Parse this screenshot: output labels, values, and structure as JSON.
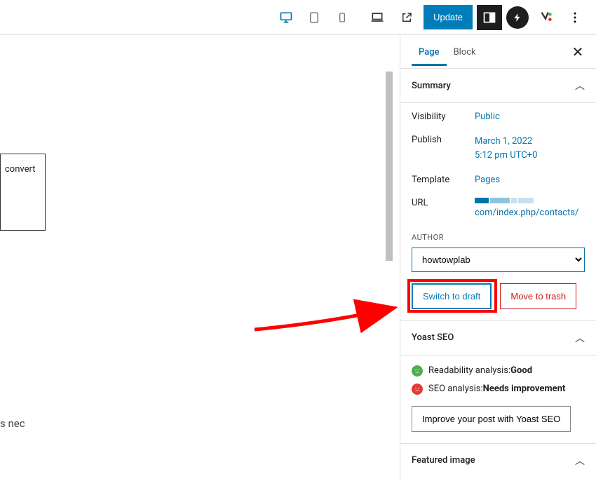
{
  "topbar": {
    "update_label": "Update"
  },
  "tabs": {
    "page_label": "Page",
    "block_label": "Block"
  },
  "summary": {
    "title": "Summary",
    "visibility_label": "Visibility",
    "visibility_value": "Public",
    "publish_label": "Publish",
    "publish_date": "March 1, 2022",
    "publish_time": "5:12 pm UTC+0",
    "template_label": "Template",
    "template_value": "Pages",
    "url_label": "URL",
    "url_value": "com/index.php/contacts/",
    "author_label": "AUTHOR",
    "author_value": "howtowplab",
    "switch_draft_label": "Switch to draft",
    "move_trash_label": "Move to trash"
  },
  "yoast": {
    "title": "Yoast SEO",
    "readability_prefix": "Readability analysis: ",
    "readability_status": "Good",
    "seo_prefix": "SEO analysis: ",
    "seo_status": "Needs improvement",
    "improve_label": "Improve your post with Yoast SEO"
  },
  "featured": {
    "title": "Featured image"
  },
  "content": {
    "fragment_box": "convert",
    "fragment_text": "s nec"
  }
}
